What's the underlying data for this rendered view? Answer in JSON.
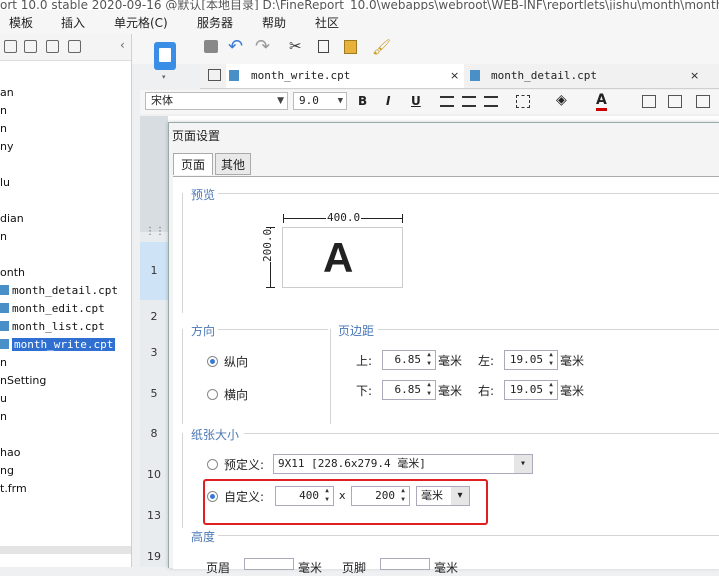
{
  "window": {
    "title_fragment": "ort 10.0 stable 2020-09-16 @默认[本地目录]     D:\\FineReport_10.0\\webapps\\webroot\\WEB-INF\\reportlets\\jishu\\month\\month"
  },
  "menubar": {
    "items": [
      "模板",
      "插入",
      "单元格(C)",
      "服务器",
      "帮助",
      "社区"
    ]
  },
  "tree": {
    "items": [
      "an",
      "n",
      "n",
      "ny",
      "lu",
      "dian",
      "n",
      "onth"
    ],
    "files": [
      "month_detail.cpt",
      "month_edit.cpt",
      "month_list.cpt",
      "month_write.cpt"
    ],
    "items_after": [
      "n",
      "nSetting",
      "u",
      "n",
      "",
      "hao",
      "ng",
      "t.frm"
    ]
  },
  "tabs": [
    {
      "label": "month_write.cpt",
      "close": "×"
    },
    {
      "label": "month_detail.cpt",
      "close": "×"
    }
  ],
  "format": {
    "font": "宋体",
    "size": "9.0",
    "bold": "B",
    "italic": "I",
    "underline": "U",
    "color_letter": "A"
  },
  "rows": [
    "1",
    "2",
    "3",
    "5",
    "8",
    "10",
    "13",
    "19"
  ],
  "dialog": {
    "title": "页面设置",
    "tabs": [
      "页面",
      "其他"
    ],
    "preview": {
      "label": "预览",
      "width": "400.0",
      "height": "200.0",
      "letter": "A"
    },
    "orientation": {
      "label": "方向",
      "portrait": "纵向",
      "landscape": "横向"
    },
    "margins": {
      "label": "页边距",
      "top_label": "上:",
      "top": "6.85",
      "bottom_label": "下:",
      "bottom": "6.85",
      "left_label": "左:",
      "left": "19.05",
      "right_label": "右:",
      "right": "19.05",
      "unit": "毫米"
    },
    "paper": {
      "label": "纸张大小",
      "predefined_label": "预定义:",
      "predefined_value": "9X11 [228.6x279.4 毫米]",
      "custom_label": "自定义:",
      "custom_width": "400",
      "times": "x",
      "custom_height": "200",
      "unit": "毫米"
    },
    "height": {
      "label": "高度",
      "header_fragment": "页眉",
      "footer_fragment": "页脚",
      "unit_fragment": "毫米"
    }
  },
  "colors": {
    "accent": "#2f6fd1",
    "highlight": "#e02020",
    "section": "#4a78b5"
  }
}
